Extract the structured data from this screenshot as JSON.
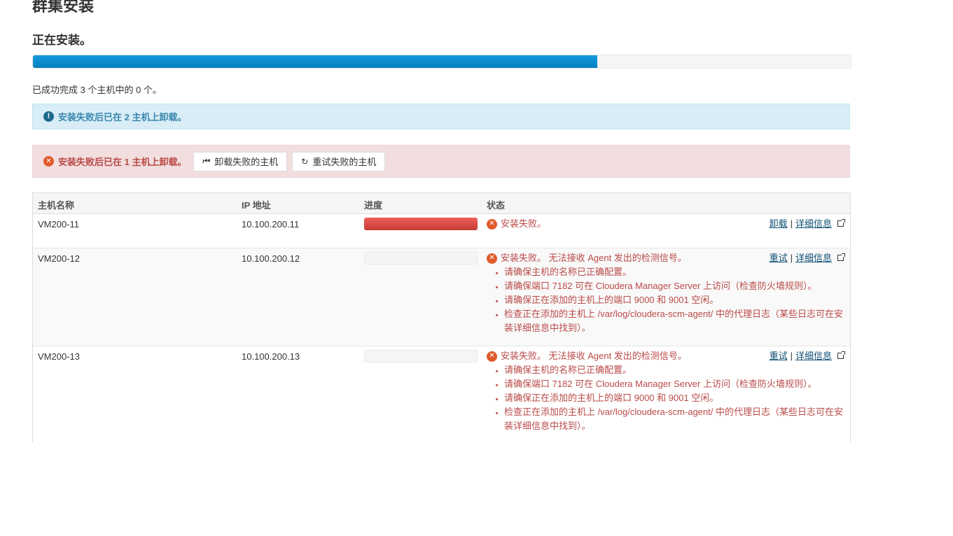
{
  "page": {
    "title": "群集安装",
    "subtitle": "正在安装。",
    "progress": 0.69,
    "summary": "已成功完成 3 个主机中的 0 个。"
  },
  "alerts": {
    "info_text": "安装失败后已在 2 主机上卸载。",
    "error_text": "安装失败后已在 1 主机上卸载。",
    "uninstall_failed_label": "卸载失败的主机",
    "retry_failed_label": "重试失败的主机"
  },
  "table": {
    "headers": {
      "hostname": "主机名称",
      "ip": "IP 地址",
      "progress": "进度",
      "status": "状态"
    },
    "rows": [
      {
        "hostname": "VM200-11",
        "ip": "10.100.200.11",
        "progress_state": "failed",
        "status": "安装失败。",
        "action1": "卸载",
        "action2": "详细信息",
        "reasons": []
      },
      {
        "hostname": "VM200-12",
        "ip": "10.100.200.12",
        "progress_state": "empty",
        "status": "安装失败。 无法接收 Agent 发出的检测信号。",
        "action1": "重试",
        "action2": "详细信息",
        "reasons": [
          "请确保主机的名称已正确配置。",
          "请确保端口 7182 可在 Cloudera Manager Server 上访问（检查防火墙规则）。",
          "请确保正在添加的主机上的端口 9000 和 9001 空闲。",
          "检查正在添加的主机上 /var/log/cloudera-scm-agent/ 中的代理日志（某些日志可在安装详细信息中找到）。"
        ]
      },
      {
        "hostname": "VM200-13",
        "ip": "10.100.200.13",
        "progress_state": "empty",
        "status": "安装失败。 无法接收 Agent 发出的检测信号。",
        "action1": "重试",
        "action2": "详细信息",
        "reasons": [
          "请确保主机的名称已正确配置。",
          "请确保端口 7182 可在 Cloudera Manager Server 上访问（检查防火墙规则）。",
          "请确保正在添加的主机上的端口 9000 和 9001 空闲。",
          "检查正在添加的主机上 /var/log/cloudera-scm-agent/ 中的代理日志（某些日志可在安装详细信息中找到）。"
        ]
      }
    ]
  },
  "icons": {
    "info": "info-circle-icon",
    "error": "error-x-circle-icon",
    "uninstall": "step-backward-icon",
    "retry": "refresh-icon",
    "external": "external-link-icon"
  },
  "colors": {
    "progress_blue": "#0480be",
    "failed_red": "#c43c35",
    "error_text": "#b94a48",
    "info_text": "#3a87ad"
  }
}
